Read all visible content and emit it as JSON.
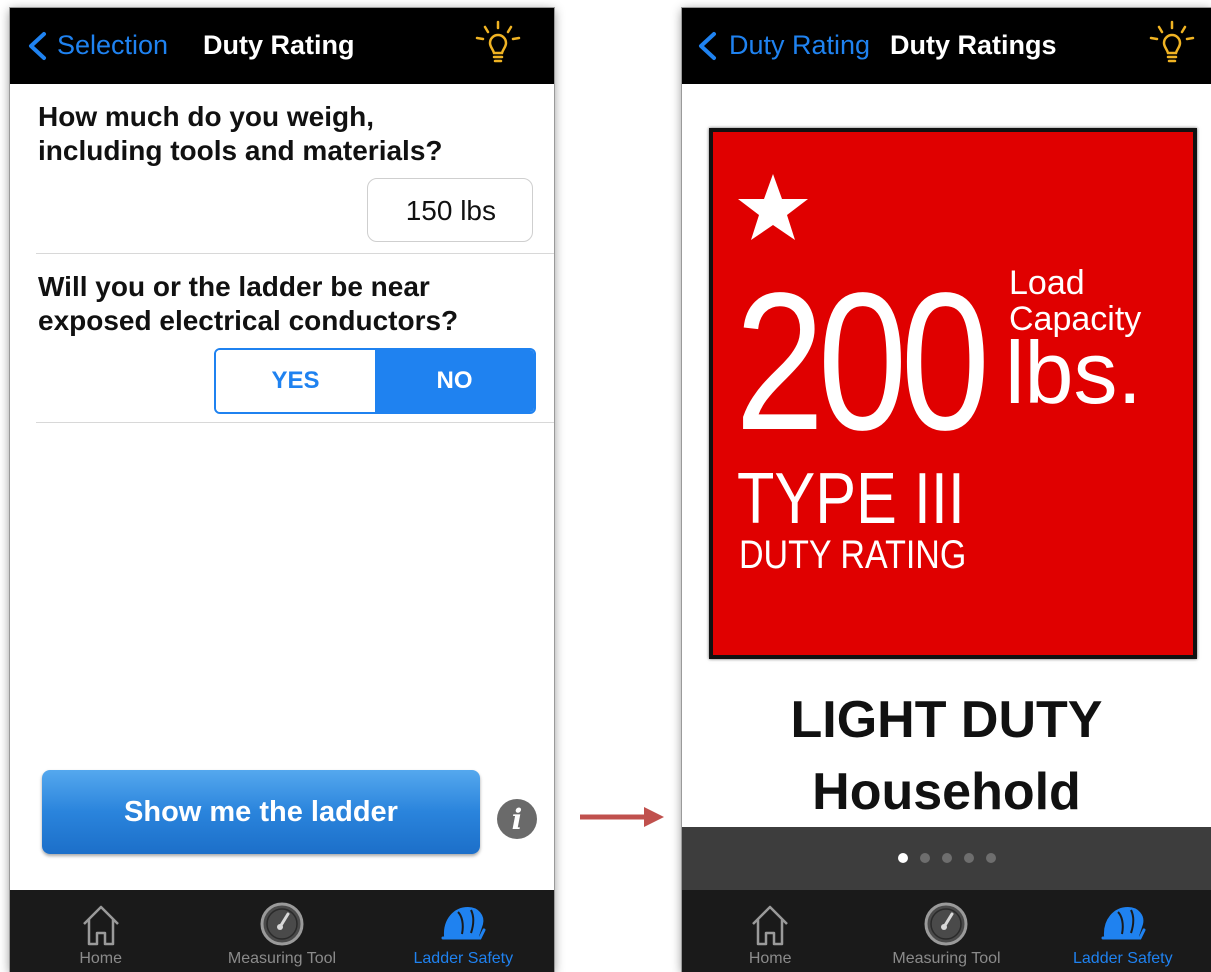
{
  "colors": {
    "accent": "#1f82f0",
    "navbar": "#000000",
    "tabbar": "#1a1a1a",
    "sign_red": "#e00000",
    "lightbulb": "#f0b323",
    "arrow": "#c0504d"
  },
  "left_screen": {
    "navbar": {
      "back_label": "Selection",
      "title": "Duty Rating",
      "right_icon": "lightbulb-icon"
    },
    "weight_question": {
      "line1": "How much do you weigh,",
      "line2": "including tools and materials?",
      "value": "150 lbs"
    },
    "electrical_question": {
      "line1": "Will you or the ladder be near",
      "line2": "exposed electrical conductors?",
      "options": [
        "YES",
        "NO"
      ],
      "selected": "NO"
    },
    "show_button_label": "Show me the ladder",
    "info_button_label": "i"
  },
  "right_screen": {
    "navbar": {
      "back_label": "Duty Rating",
      "title": "Duty Ratings",
      "right_icon": "lightbulb-icon"
    },
    "sign": {
      "capacity": "200",
      "load_line1": "Load",
      "load_line2": "Capacity",
      "unit": "lbs.",
      "type": "TYPE III",
      "rating": "DUTY RATING"
    },
    "duty_title": "LIGHT DUTY",
    "duty_subtitle": "Household",
    "pager": {
      "pages": 5,
      "current": 1
    }
  },
  "tabbar": {
    "tabs": [
      {
        "label": "Home",
        "icon": "home-icon",
        "active": false
      },
      {
        "label": "Measuring Tool",
        "icon": "gauge-icon",
        "active": false
      },
      {
        "label": "Ladder Safety",
        "icon": "hard-hat-icon",
        "active": true
      }
    ]
  }
}
